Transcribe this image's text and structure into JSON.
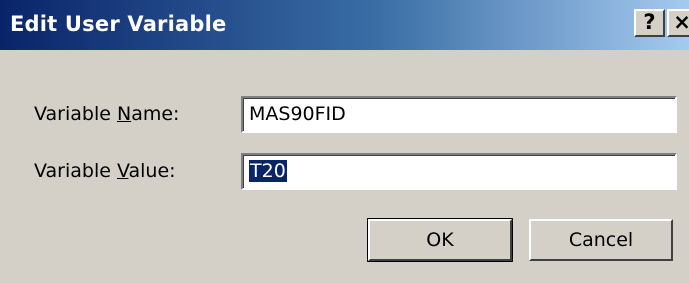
{
  "window": {
    "title": "Edit User Variable",
    "help_label": "?",
    "close_label": "×"
  },
  "form": {
    "name_label_pre": "Variable ",
    "name_label_accel": "N",
    "name_label_post": "ame:",
    "name_value": "MAS90FID",
    "value_label_pre": "Variable ",
    "value_label_accel": "V",
    "value_label_post": "alue:",
    "value_value": "T20"
  },
  "buttons": {
    "ok": "OK",
    "cancel": "Cancel"
  }
}
